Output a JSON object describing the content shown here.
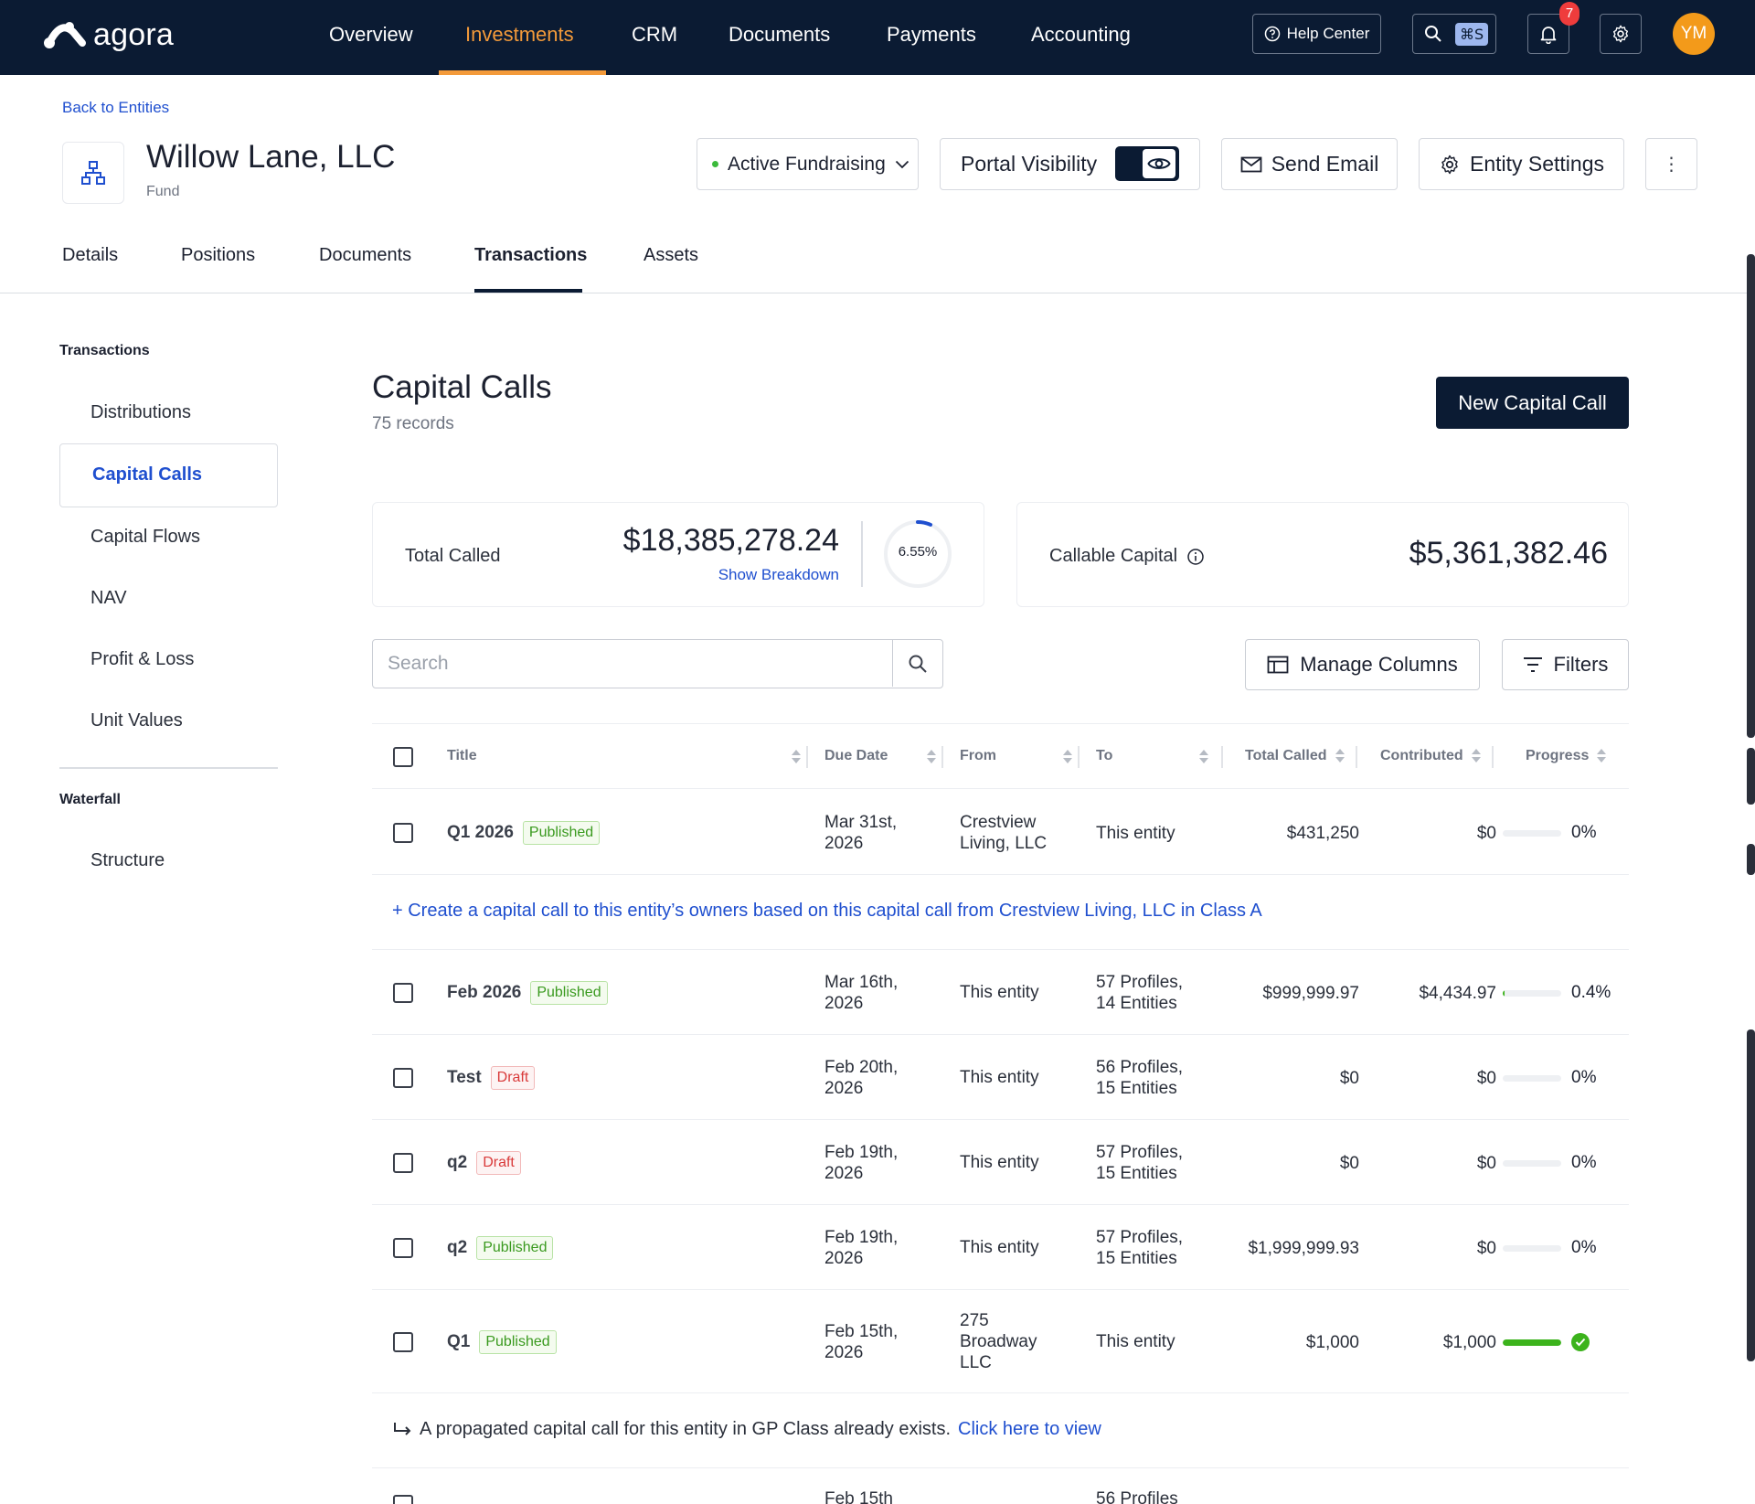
{
  "brand": {
    "name": "agora"
  },
  "nav": {
    "items": [
      "Overview",
      "Investments",
      "CRM",
      "Documents",
      "Payments",
      "Accounting"
    ],
    "active": "Investments",
    "help_label": "Help Center",
    "search_shortcut": "⌘S",
    "notifications_count": "7",
    "avatar_initials": "YM"
  },
  "entity": {
    "back_label": "Back to Entities",
    "name": "Willow Lane, LLC",
    "type": "Fund",
    "fundraising_status": "Active Fundraising",
    "portal_visibility_label": "Portal Visibility",
    "portal_visibility_on": true,
    "send_email_label": "Send Email",
    "settings_label": "Entity Settings",
    "more_label": "⋮"
  },
  "tabs": [
    "Details",
    "Positions",
    "Documents",
    "Transactions",
    "Assets"
  ],
  "active_tab": "Transactions",
  "sidebar": {
    "section1_title": "Transactions",
    "section1_items": [
      "Distributions",
      "Capital Calls",
      "Capital Flows",
      "NAV",
      "Profit & Loss",
      "Unit Values"
    ],
    "active_item": "Capital Calls",
    "section2_title": "Waterfall",
    "section2_items": [
      "Structure"
    ]
  },
  "page": {
    "title": "Capital Calls",
    "records": "75 records",
    "new_button": "New Capital Call"
  },
  "summary": {
    "total_called_label": "Total Called",
    "total_called_value": "$18,385,278.24",
    "show_breakdown": "Show Breakdown",
    "called_percent": "6.55%",
    "called_fraction": 0.0655,
    "callable_label": "Callable Capital",
    "callable_value": "$5,361,382.46"
  },
  "toolbar": {
    "search_placeholder": "Search",
    "manage_columns": "Manage Columns",
    "filters": "Filters"
  },
  "table": {
    "columns": [
      "Title",
      "Due Date",
      "From",
      "To",
      "Total Called",
      "Contributed",
      "Progress"
    ],
    "rows": [
      {
        "title": "Q1 2026",
        "status": "Published",
        "due1": "Mar 31st,",
        "due2": "2026",
        "from1": "Crestview",
        "from2": "Living, LLC",
        "from3": "",
        "to1": "This entity",
        "to2": "",
        "total": "$431,250",
        "contributed": "$0",
        "progress_text": "0%",
        "progress": 0
      },
      {
        "title": "Feb 2026",
        "status": "Published",
        "due1": "Mar 16th,",
        "due2": "2026",
        "from1": "This entity",
        "from2": "",
        "from3": "",
        "to1": "57 Profiles,",
        "to2": "14 Entities",
        "total": "$999,999.97",
        "contributed": "$4,434.97",
        "progress_text": "0.4%",
        "progress": 0.004
      },
      {
        "title": "Test",
        "status": "Draft",
        "due1": "Feb 20th,",
        "due2": "2026",
        "from1": "This entity",
        "from2": "",
        "from3": "",
        "to1": "56 Profiles,",
        "to2": "15 Entities",
        "total": "$0",
        "contributed": "$0",
        "progress_text": "0%",
        "progress": 0
      },
      {
        "title": "q2",
        "status": "Draft",
        "due1": "Feb 19th,",
        "due2": "2026",
        "from1": "This entity",
        "from2": "",
        "from3": "",
        "to1": "57 Profiles,",
        "to2": "15 Entities",
        "total": "$0",
        "contributed": "$0",
        "progress_text": "0%",
        "progress": 0
      },
      {
        "title": "q2",
        "status": "Published",
        "due1": "Feb 19th,",
        "due2": "2026",
        "from1": "This entity",
        "from2": "",
        "from3": "",
        "to1": "57 Profiles,",
        "to2": "15 Entities",
        "total": "$1,999,999.93",
        "contributed": "$0",
        "progress_text": "0%",
        "progress": 0
      },
      {
        "title": "Q1",
        "status": "Published",
        "due1": "Feb 15th,",
        "due2": "2026",
        "from1": "275",
        "from2": "Broadway",
        "from3": "LLC",
        "to1": "This entity",
        "to2": "",
        "total": "$1,000",
        "contributed": "$1,000",
        "progress_text": "",
        "progress": 1
      }
    ],
    "banner1": "+ Create a capital call to this entity’s owners based on this capital call from Crestview Living, LLC in Class A",
    "banner2_text": "A propagated capital call for this entity in GP Class already exists.",
    "banner2_link": "Click here to view",
    "partial_row": {
      "due1": "Feb 15th",
      "to1": "56 Profiles"
    }
  }
}
